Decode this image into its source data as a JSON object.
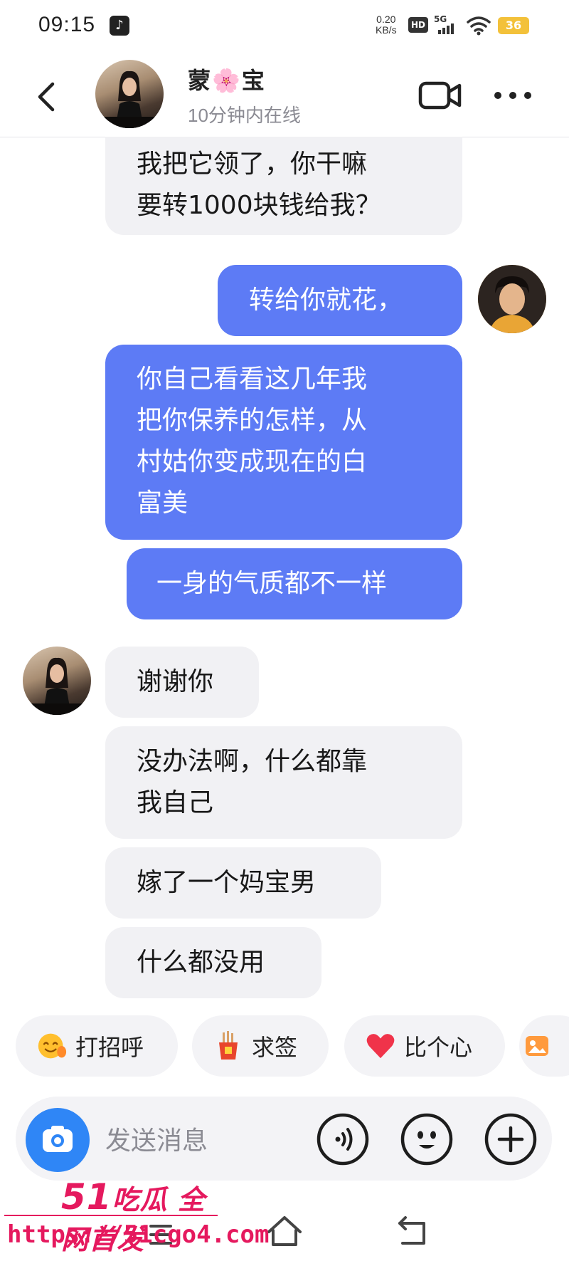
{
  "status_bar": {
    "time": "09:15",
    "speed_value": "0.20",
    "speed_unit": "KB/s",
    "hd_label": "HD",
    "network_label": "5G",
    "battery": "36"
  },
  "header": {
    "contact_name": "蒙🌸宝",
    "contact_status": "10分钟内在线"
  },
  "messages": [
    {
      "side": "received",
      "text": "我把它领了，你干嘛\n要转1000块钱给我？"
    },
    {
      "side": "sent",
      "text": "转给你就花，"
    },
    {
      "side": "sent",
      "text": "你自己看看这几年我\n把你保养的怎样，从\n村姑你变成现在的白\n富美"
    },
    {
      "side": "sent",
      "text": "一身的气质都不一样"
    },
    {
      "side": "received",
      "text": "谢谢你"
    },
    {
      "side": "received",
      "text": "没办法啊，什么都靠\n我自己"
    },
    {
      "side": "received",
      "text": "嫁了一个妈宝男"
    },
    {
      "side": "received",
      "text": "什么都没用"
    }
  ],
  "quick_replies": [
    {
      "label": "打招呼",
      "icon": "smile-wave-icon"
    },
    {
      "label": "求签",
      "icon": "fortune-sticks-icon"
    },
    {
      "label": "比个心",
      "icon": "heart-icon"
    }
  ],
  "input": {
    "placeholder": "发送消息"
  },
  "watermark": {
    "line1_number": "51",
    "line1_text": "吃瓜 全网首发",
    "line2": "https://51cgo4.com"
  },
  "colors": {
    "sent_bubble": "#5d7bf5",
    "received_bubble": "#f1f1f4",
    "camera_button": "#2f86f6",
    "battery": "#f3c13a",
    "watermark": "#e5195e"
  }
}
